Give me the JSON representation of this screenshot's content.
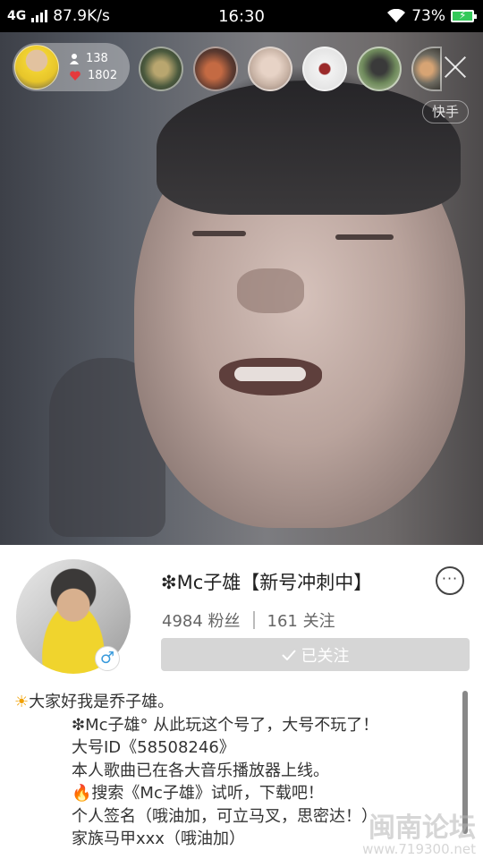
{
  "status_bar": {
    "network": "4G",
    "speed": "87.9K/s",
    "time": "16:30",
    "battery": "73%"
  },
  "live_overlay": {
    "host_stats": {
      "viewers": "138",
      "likes": "1802"
    },
    "platform_badge": "快手"
  },
  "profile": {
    "username": "❇Mc子雄【新号冲刺中】",
    "fans_count": "4984 粉丝",
    "following_count": "161 关注",
    "follow_button_label": "已关注",
    "gender_symbol": "♂",
    "more_symbol": "···",
    "bio_lines": [
      "大家好我是乔子雄。",
      "❇Mc子雄°  从此玩这个号了，大号不玩了！",
      "大号ID《58508246》",
      "本人歌曲已在各大音乐播放器上线。",
      "搜索《Mc子雄》试听，下载吧！",
      "个人签名（哦油加，可立马叉，思密达！）",
      "家族马甲xxx（哦油加）"
    ]
  },
  "watermark": {
    "text": "闽南论坛",
    "url": "www.719300.net"
  },
  "colors": {
    "follow_button_bg": "#d6d6d6",
    "gender_blue": "#3a9bdc"
  }
}
